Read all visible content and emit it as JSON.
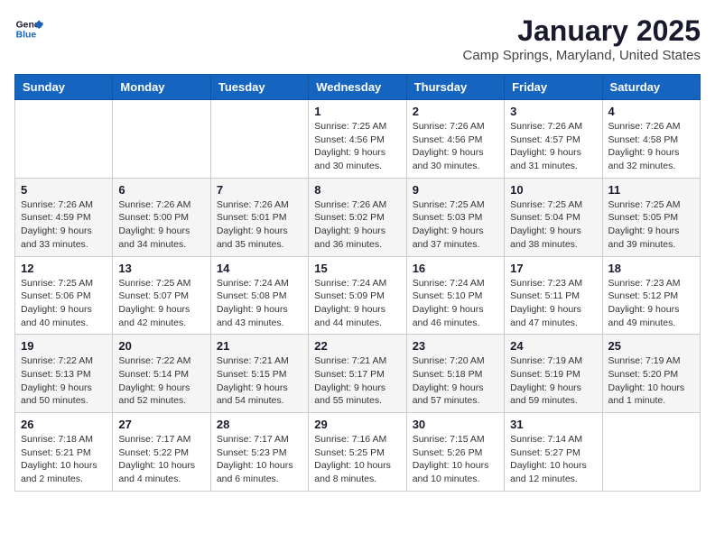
{
  "header": {
    "logo_line1": "General",
    "logo_line2": "Blue",
    "month": "January 2025",
    "location": "Camp Springs, Maryland, United States"
  },
  "weekdays": [
    "Sunday",
    "Monday",
    "Tuesday",
    "Wednesday",
    "Thursday",
    "Friday",
    "Saturday"
  ],
  "weeks": [
    [
      {
        "day": "",
        "info": ""
      },
      {
        "day": "",
        "info": ""
      },
      {
        "day": "",
        "info": ""
      },
      {
        "day": "1",
        "info": "Sunrise: 7:25 AM\nSunset: 4:56 PM\nDaylight: 9 hours\nand 30 minutes."
      },
      {
        "day": "2",
        "info": "Sunrise: 7:26 AM\nSunset: 4:56 PM\nDaylight: 9 hours\nand 30 minutes."
      },
      {
        "day": "3",
        "info": "Sunrise: 7:26 AM\nSunset: 4:57 PM\nDaylight: 9 hours\nand 31 minutes."
      },
      {
        "day": "4",
        "info": "Sunrise: 7:26 AM\nSunset: 4:58 PM\nDaylight: 9 hours\nand 32 minutes."
      }
    ],
    [
      {
        "day": "5",
        "info": "Sunrise: 7:26 AM\nSunset: 4:59 PM\nDaylight: 9 hours\nand 33 minutes."
      },
      {
        "day": "6",
        "info": "Sunrise: 7:26 AM\nSunset: 5:00 PM\nDaylight: 9 hours\nand 34 minutes."
      },
      {
        "day": "7",
        "info": "Sunrise: 7:26 AM\nSunset: 5:01 PM\nDaylight: 9 hours\nand 35 minutes."
      },
      {
        "day": "8",
        "info": "Sunrise: 7:26 AM\nSunset: 5:02 PM\nDaylight: 9 hours\nand 36 minutes."
      },
      {
        "day": "9",
        "info": "Sunrise: 7:25 AM\nSunset: 5:03 PM\nDaylight: 9 hours\nand 37 minutes."
      },
      {
        "day": "10",
        "info": "Sunrise: 7:25 AM\nSunset: 5:04 PM\nDaylight: 9 hours\nand 38 minutes."
      },
      {
        "day": "11",
        "info": "Sunrise: 7:25 AM\nSunset: 5:05 PM\nDaylight: 9 hours\nand 39 minutes."
      }
    ],
    [
      {
        "day": "12",
        "info": "Sunrise: 7:25 AM\nSunset: 5:06 PM\nDaylight: 9 hours\nand 40 minutes."
      },
      {
        "day": "13",
        "info": "Sunrise: 7:25 AM\nSunset: 5:07 PM\nDaylight: 9 hours\nand 42 minutes."
      },
      {
        "day": "14",
        "info": "Sunrise: 7:24 AM\nSunset: 5:08 PM\nDaylight: 9 hours\nand 43 minutes."
      },
      {
        "day": "15",
        "info": "Sunrise: 7:24 AM\nSunset: 5:09 PM\nDaylight: 9 hours\nand 44 minutes."
      },
      {
        "day": "16",
        "info": "Sunrise: 7:24 AM\nSunset: 5:10 PM\nDaylight: 9 hours\nand 46 minutes."
      },
      {
        "day": "17",
        "info": "Sunrise: 7:23 AM\nSunset: 5:11 PM\nDaylight: 9 hours\nand 47 minutes."
      },
      {
        "day": "18",
        "info": "Sunrise: 7:23 AM\nSunset: 5:12 PM\nDaylight: 9 hours\nand 49 minutes."
      }
    ],
    [
      {
        "day": "19",
        "info": "Sunrise: 7:22 AM\nSunset: 5:13 PM\nDaylight: 9 hours\nand 50 minutes."
      },
      {
        "day": "20",
        "info": "Sunrise: 7:22 AM\nSunset: 5:14 PM\nDaylight: 9 hours\nand 52 minutes."
      },
      {
        "day": "21",
        "info": "Sunrise: 7:21 AM\nSunset: 5:15 PM\nDaylight: 9 hours\nand 54 minutes."
      },
      {
        "day": "22",
        "info": "Sunrise: 7:21 AM\nSunset: 5:17 PM\nDaylight: 9 hours\nand 55 minutes."
      },
      {
        "day": "23",
        "info": "Sunrise: 7:20 AM\nSunset: 5:18 PM\nDaylight: 9 hours\nand 57 minutes."
      },
      {
        "day": "24",
        "info": "Sunrise: 7:19 AM\nSunset: 5:19 PM\nDaylight: 9 hours\nand 59 minutes."
      },
      {
        "day": "25",
        "info": "Sunrise: 7:19 AM\nSunset: 5:20 PM\nDaylight: 10 hours\nand 1 minute."
      }
    ],
    [
      {
        "day": "26",
        "info": "Sunrise: 7:18 AM\nSunset: 5:21 PM\nDaylight: 10 hours\nand 2 minutes."
      },
      {
        "day": "27",
        "info": "Sunrise: 7:17 AM\nSunset: 5:22 PM\nDaylight: 10 hours\nand 4 minutes."
      },
      {
        "day": "28",
        "info": "Sunrise: 7:17 AM\nSunset: 5:23 PM\nDaylight: 10 hours\nand 6 minutes."
      },
      {
        "day": "29",
        "info": "Sunrise: 7:16 AM\nSunset: 5:25 PM\nDaylight: 10 hours\nand 8 minutes."
      },
      {
        "day": "30",
        "info": "Sunrise: 7:15 AM\nSunset: 5:26 PM\nDaylight: 10 hours\nand 10 minutes."
      },
      {
        "day": "31",
        "info": "Sunrise: 7:14 AM\nSunset: 5:27 PM\nDaylight: 10 hours\nand 12 minutes."
      },
      {
        "day": "",
        "info": ""
      }
    ]
  ]
}
